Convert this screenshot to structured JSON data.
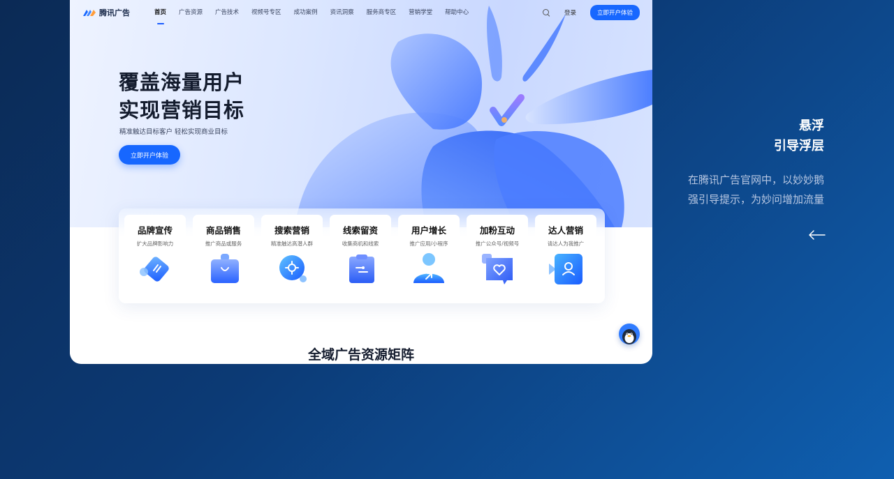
{
  "nav": {
    "logo_text": "腾讯广告",
    "items": [
      {
        "label": "首页",
        "active": true
      },
      {
        "label": "广告资源"
      },
      {
        "label": "广告技术"
      },
      {
        "label": "视频号专区"
      },
      {
        "label": "成功案例"
      },
      {
        "label": "资讯洞察"
      },
      {
        "label": "服务商专区"
      },
      {
        "label": "营销学堂"
      },
      {
        "label": "帮助中心"
      }
    ],
    "login": "登录",
    "cta": "立即开户体验"
  },
  "hero": {
    "title_line1": "覆盖海量用户",
    "title_line2": "实现营销目标",
    "subtitle": "精准触达目标客户  轻松实现商业目标",
    "cta": "立即开户体验"
  },
  "services": [
    {
      "title": "品牌宣传",
      "desc": "扩大品牌影响力",
      "icon": "tag-icon"
    },
    {
      "title": "商品销售",
      "desc": "推广商品或服务",
      "icon": "shopping-bag-icon"
    },
    {
      "title": "搜索营销",
      "desc": "精准触达高潜人群",
      "icon": "target-search-icon"
    },
    {
      "title": "线索留资",
      "desc": "收集商机和线索",
      "icon": "clipboard-icon"
    },
    {
      "title": "用户增长",
      "desc": "推广应用/小程序",
      "icon": "user-growth-icon"
    },
    {
      "title": "加粉互动",
      "desc": "推广公众号/视频号",
      "icon": "heart-chat-icon"
    },
    {
      "title": "达人营销",
      "desc": "请达人为我推广",
      "icon": "influencer-icon"
    }
  ],
  "section_title": "全域广告资源矩阵",
  "annotation": {
    "title_line1": "悬浮",
    "title_line2": "引导浮层",
    "desc_line1": "在腾讯广告官网中，以妙妙鹅",
    "desc_line2": "强引导提示，为妙问增加流量"
  },
  "colors": {
    "accent": "#1767ff",
    "background_dark": "#0b2a55",
    "annotation_text": "#b8c7e2"
  }
}
